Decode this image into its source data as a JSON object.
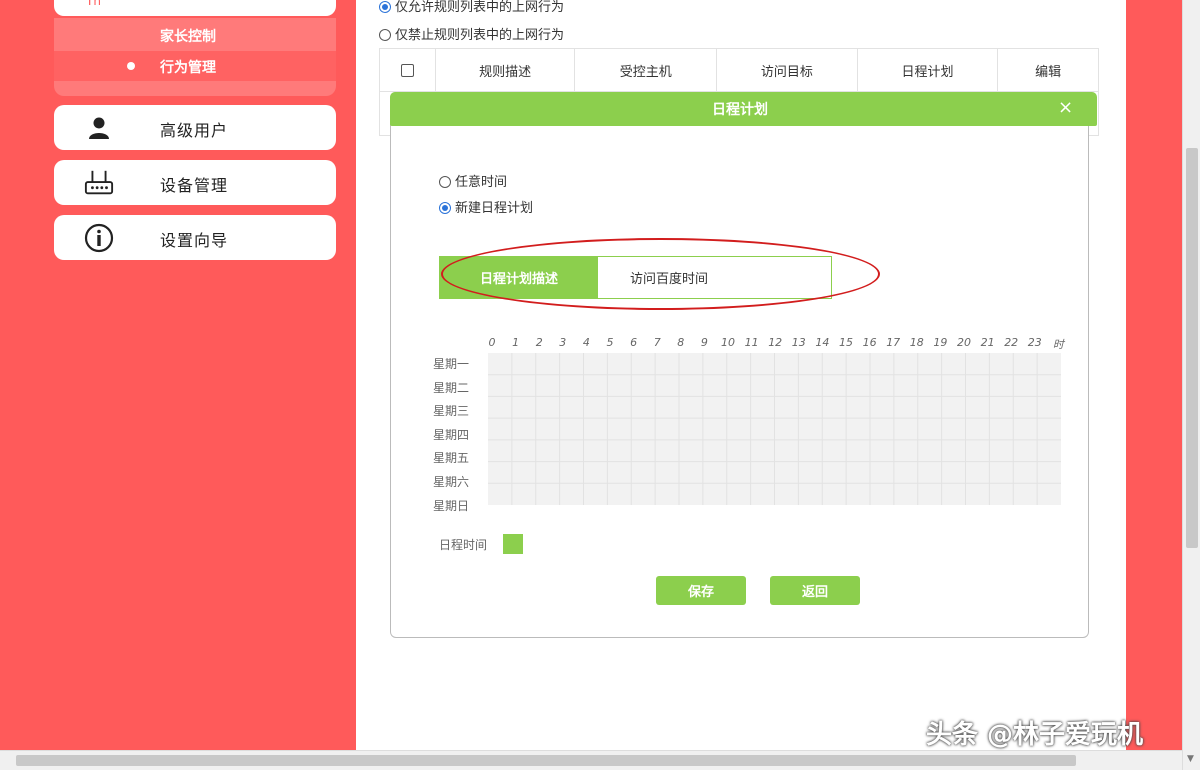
{
  "sidebar": {
    "top_mark": "Th",
    "subitems": [
      {
        "label": "家长控制"
      },
      {
        "label": "行为管理"
      }
    ],
    "items": [
      {
        "label": "高级用户",
        "icon": "user-icon"
      },
      {
        "label": "设备管理",
        "icon": "router-icon"
      },
      {
        "label": "设置向导",
        "icon": "info-icon"
      }
    ]
  },
  "main": {
    "radio_options": [
      {
        "label": "仅允许规则列表中的上网行为",
        "selected": true
      },
      {
        "label": "仅禁止规则列表中的上网行为",
        "selected": false
      }
    ],
    "table": {
      "columns": [
        "规则描述",
        "受控主机",
        "访问目标",
        "日程计划",
        "编辑"
      ]
    }
  },
  "dialog": {
    "title": "日程计划",
    "close": "×",
    "options": [
      {
        "label": "任意时间",
        "selected": false
      },
      {
        "label": "新建日程计划",
        "selected": true
      }
    ],
    "plan_label": "日程计划描述",
    "plan_value": "访问百度时间",
    "hours": [
      "0",
      "1",
      "2",
      "3",
      "4",
      "5",
      "6",
      "7",
      "8",
      "9",
      "10",
      "11",
      "12",
      "13",
      "14",
      "15",
      "16",
      "17",
      "18",
      "19",
      "20",
      "21",
      "22",
      "23",
      "时"
    ],
    "days": [
      "星期一",
      "星期二",
      "星期三",
      "星期四",
      "星期五",
      "星期六",
      "星期日"
    ],
    "legend": "日程时间",
    "accent_color": "#8ccf4d",
    "buttons": {
      "save": "保存",
      "cancel": "返回"
    }
  },
  "watermark": "头条 @林子爱玩机"
}
